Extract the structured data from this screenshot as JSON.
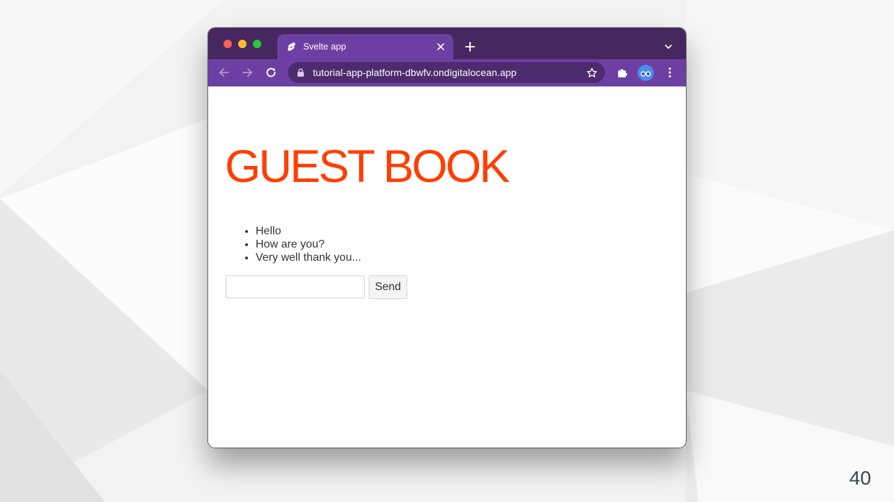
{
  "browser": {
    "tab": {
      "title": "Svelte app",
      "favicon": "svelte-icon"
    },
    "address_bar": {
      "url": "tutorial-app-platform-dbwfv.ondigitalocean.app"
    },
    "colors": {
      "titlebar": "#47275f",
      "toolbar": "#6e3fa3",
      "omnibox": "#4e2b6e"
    }
  },
  "page": {
    "heading": "GUEST BOOK",
    "heading_color": "#ff3e00",
    "messages": [
      "Hello",
      "How are you?",
      "Very well thank you..."
    ],
    "input": {
      "value": "",
      "placeholder": ""
    },
    "send_label": "Send"
  },
  "slide": {
    "number": "40"
  }
}
